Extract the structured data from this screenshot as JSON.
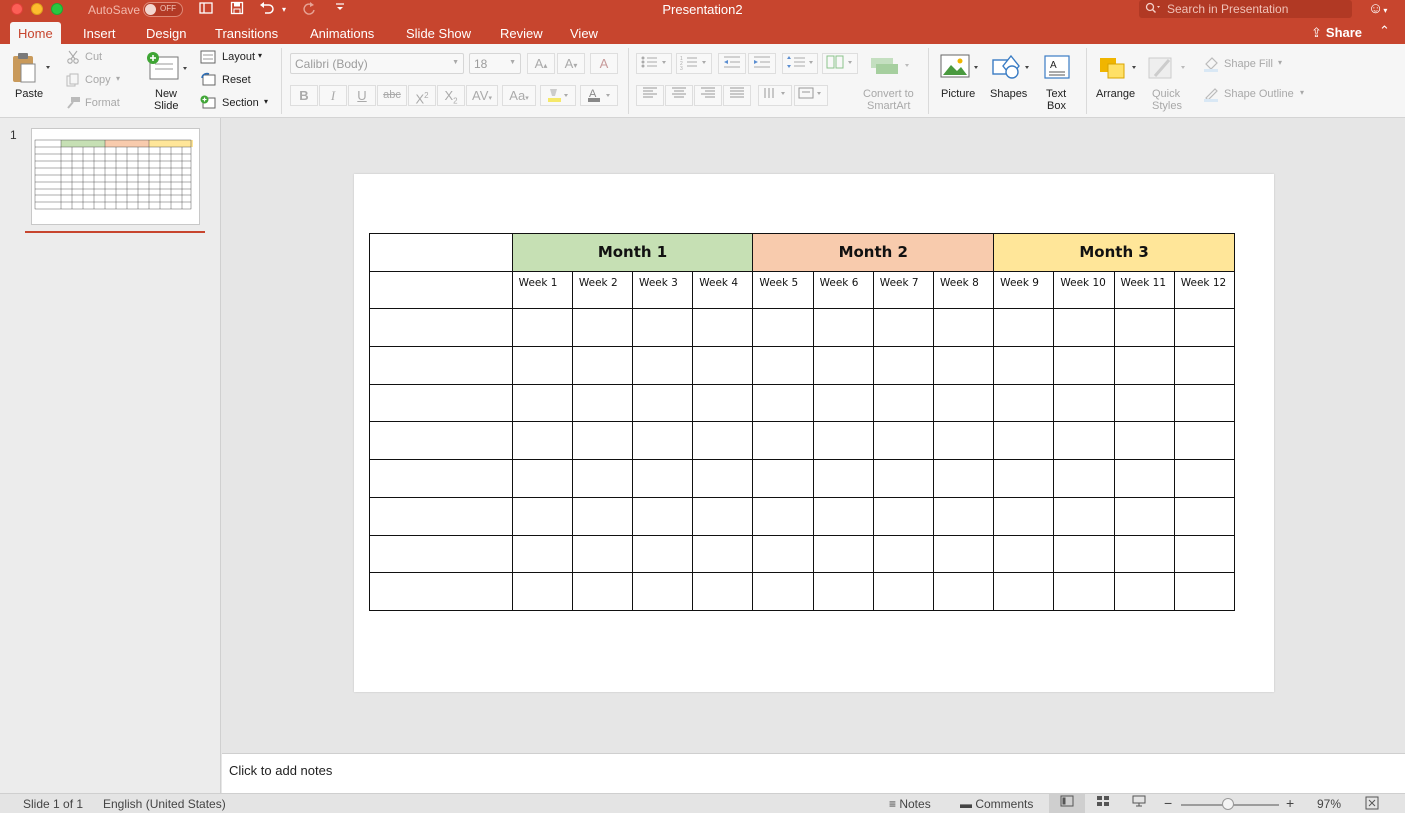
{
  "app": {
    "title": "Presentation2",
    "autosave_label": "AutoSave",
    "autosave_state": "OFF",
    "search_placeholder": "Search in Presentation"
  },
  "tabs": [
    "Home",
    "Insert",
    "Design",
    "Transitions",
    "Animations",
    "Slide Show",
    "Review",
    "View"
  ],
  "share_label": "Share",
  "ribbon": {
    "paste": "Paste",
    "cut": "Cut",
    "copy": "Copy",
    "format": "Format",
    "new_slide_1": "New",
    "new_slide_2": "Slide",
    "layout": "Layout",
    "reset": "Reset",
    "section": "Section",
    "font_name": "Calibri (Body)",
    "font_size": "18",
    "convert_1": "Convert to",
    "convert_2": "SmartArt",
    "picture": "Picture",
    "shapes": "Shapes",
    "text_box_1": "Text",
    "text_box_2": "Box",
    "arrange": "Arrange",
    "quick_styles_1": "Quick",
    "quick_styles_2": "Styles",
    "shape_fill": "Shape Fill",
    "shape_outline": "Shape Outline"
  },
  "slides_panel": {
    "slide_number": "1"
  },
  "slide": {
    "months": [
      "Month 1",
      "Month 2",
      "Month 3"
    ],
    "month_colors": [
      "#c6e0b4",
      "#f8cbad",
      "#ffe699"
    ],
    "weeks": [
      "Week 1",
      "Week 2",
      "Week 3",
      "Week 4",
      "Week 5",
      "Week 6",
      "Week 7",
      "Week 8",
      "Week 9",
      "Week 10",
      "Week 11",
      "Week 12"
    ],
    "body_rows": 8
  },
  "notes_placeholder": "Click to add notes",
  "status": {
    "slide_info": "Slide 1 of 1",
    "language": "English (United States)",
    "notes": "Notes",
    "comments": "Comments",
    "zoom": "97%"
  }
}
